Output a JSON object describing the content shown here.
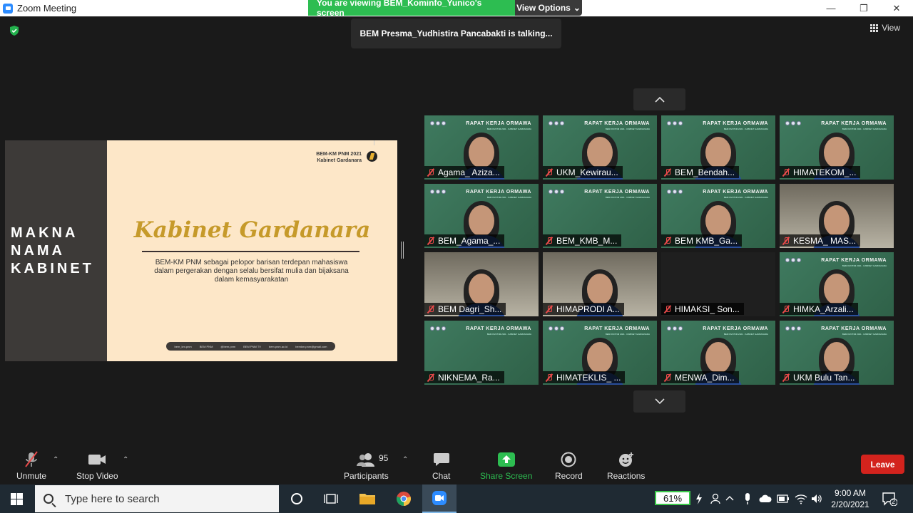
{
  "window": {
    "title": "Zoom Meeting",
    "minimize": "—",
    "restore": "❐",
    "close": "✕"
  },
  "banner": {
    "viewing_text": "You are viewing BEM_Kominfo_Yunico's screen",
    "view_options": "View Options",
    "view_options_caret": "⌄"
  },
  "talking": "BEM Presma_Yudhistira Pancabakti is talking...",
  "view_label": "View",
  "slide": {
    "side_lines": [
      "MAKNA",
      "NAMA",
      "KABINET"
    ],
    "brand_line1": "BEM-KM PNM 2021",
    "brand_line2": "Kabinet Gardanara",
    "title": "Kabinet Gardanara",
    "description": "BEM-KM PNM sebagai pelopor barisan terdepan mahasiswa dalam pergerakan dengan selalu bersifat mulia dan bijaksana dalam kemasyarakatan",
    "footer_items": [
      "bem_km.pnm",
      "BEM PNM",
      "@bem.pnm",
      "BEM PNM TV",
      "bem.pnm.ac.id",
      "bemkm.pnm@gmail.com"
    ]
  },
  "tile_banner": {
    "title": "RAPAT KERJA ORMAWA",
    "subtitle": "BEM KM PNM 2021 · KABINET GARDANARA"
  },
  "participants_tiles": [
    {
      "name": "Agama_ Aziza...",
      "style": "green",
      "person": true
    },
    {
      "name": "UKM_Kewirau...",
      "style": "green",
      "person": true
    },
    {
      "name": "BEM_Bendah...",
      "style": "green",
      "person": true
    },
    {
      "name": "HIMATEKOM_...",
      "style": "green",
      "person": true
    },
    {
      "name": "BEM_Agama_...",
      "style": "green",
      "person": true
    },
    {
      "name": "BEM_KMB_M...",
      "style": "green",
      "person": false
    },
    {
      "name": "BEM KMB_Ga...",
      "style": "green",
      "person": true
    },
    {
      "name": "KESMA_ MAS...",
      "style": "room",
      "person": true
    },
    {
      "name": "BEM Dagri_Sh...",
      "style": "room",
      "person": true
    },
    {
      "name": "HIMAPRODI A...",
      "style": "room",
      "person": true
    },
    {
      "name": "HIMAKSI_ Son...",
      "style": "dark",
      "person": false
    },
    {
      "name": "HIMKA_Arzali...",
      "style": "green",
      "person": true
    },
    {
      "name": "NIKNEMA_Ra...",
      "style": "green",
      "person": false
    },
    {
      "name": "HIMATEKLIS_ ...",
      "style": "green",
      "person": true
    },
    {
      "name": "MENWA_Dim...",
      "style": "green",
      "person": true
    },
    {
      "name": "UKM Bulu Tan...",
      "style": "green",
      "person": true
    }
  ],
  "toolbar": {
    "unmute": "Unmute",
    "stop_video": "Stop Video",
    "participants": "Participants",
    "participants_count": "95",
    "chat": "Chat",
    "share_screen": "Share Screen",
    "record": "Record",
    "reactions": "Reactions",
    "leave": "Leave",
    "caret": "⌃"
  },
  "taskbar": {
    "search_placeholder": "Type here to search",
    "battery": "61%",
    "time": "9:00 AM",
    "date": "2/20/2021",
    "notifications": "2"
  },
  "colors": {
    "accent_green": "#2dbd51",
    "leave_red": "#d3231d",
    "zoom_blue": "#2d8cff"
  }
}
